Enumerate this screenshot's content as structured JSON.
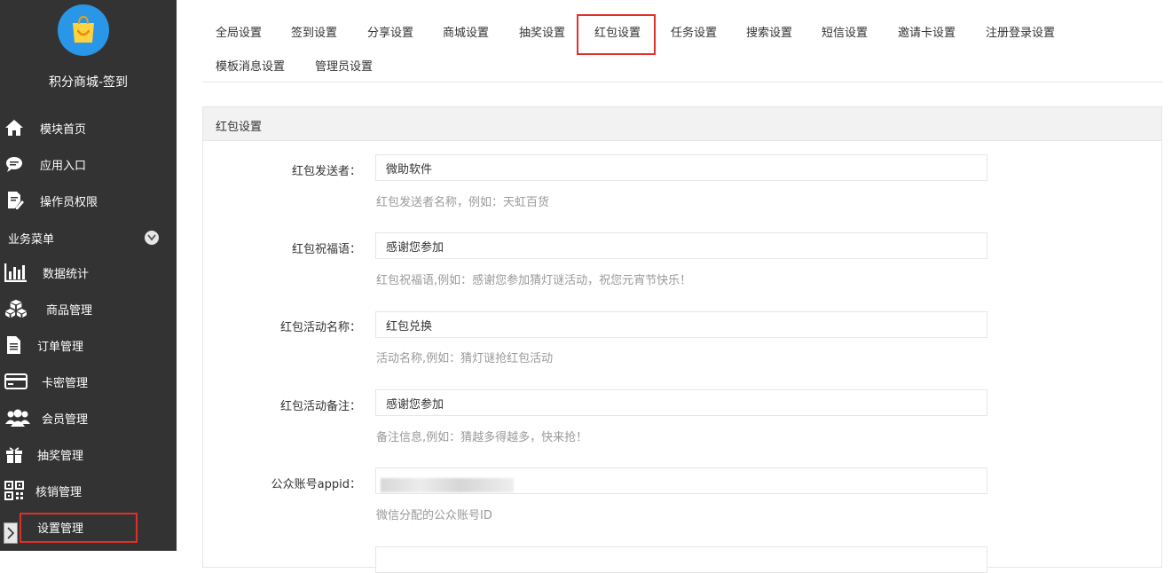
{
  "app": {
    "title": "积分商城-签到"
  },
  "sidebar": {
    "top_items": [
      {
        "label": "模块首页",
        "icon": "home-icon"
      },
      {
        "label": "应用入口",
        "icon": "chat-bubble-icon"
      },
      {
        "label": "操作员权限",
        "icon": "document-edit-icon"
      }
    ],
    "section": {
      "label": "业务菜单",
      "icon": "chevron-down-icon"
    },
    "business_items": [
      {
        "label": "数据统计",
        "icon": "bar-chart-icon"
      },
      {
        "label": "商品管理",
        "icon": "boxes-icon"
      },
      {
        "label": "订单管理",
        "icon": "document-icon"
      },
      {
        "label": "卡密管理",
        "icon": "credit-card-icon"
      },
      {
        "label": "会员管理",
        "icon": "users-icon"
      },
      {
        "label": "抽奖管理",
        "icon": "gift-icon"
      },
      {
        "label": "核销管理",
        "icon": "qrcode-icon"
      },
      {
        "label": "设置管理",
        "icon": "gear-icon"
      }
    ]
  },
  "tabs": [
    "全局设置",
    "签到设置",
    "分享设置",
    "商城设置",
    "抽奖设置",
    "红包设置",
    "任务设置",
    "搜索设置",
    "短信设置",
    "邀请卡设置",
    "注册登录设置",
    "模板消息设置",
    "管理员设置"
  ],
  "active_tab": "红包设置",
  "panel": {
    "title": "红包设置",
    "fields": [
      {
        "label": "红包发送者：",
        "value": "微助软件",
        "hint": "红包发送者名称，例如：天虹百货"
      },
      {
        "label": "红包祝福语：",
        "value": "感谢您参加",
        "hint": "红包祝福语,例如：感谢您参加猜灯谜活动，祝您元宵节快乐！"
      },
      {
        "label": "红包活动名称：",
        "value": "红包兑换",
        "hint": "活动名称,例如：猜灯谜抢红包活动"
      },
      {
        "label": "红包活动备注：",
        "value": "感谢您参加",
        "hint": "备注信息,例如：猜越多得越多，快来抢！"
      },
      {
        "label": "公众账号appid：",
        "value": "",
        "hint": "微信分配的公众账号ID"
      }
    ]
  },
  "colors": {
    "sidebar_bg": "#333333",
    "highlight": "#e0302b",
    "logo_bg": "#2a96e8",
    "logo_bag": "#ffd23f"
  }
}
